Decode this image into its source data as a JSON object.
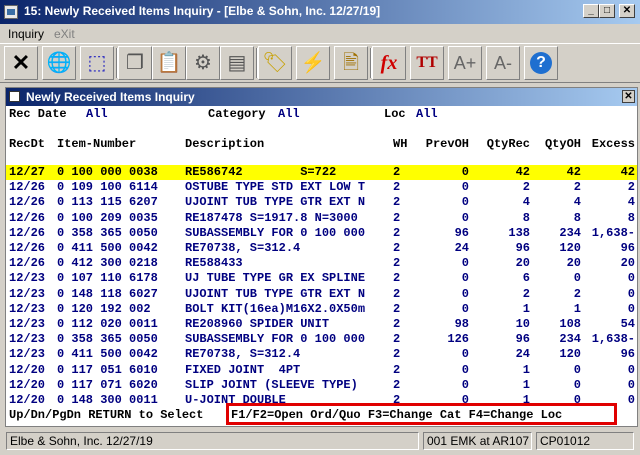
{
  "window": {
    "title": "15: Newly Received Items Inquiry - [Elbe & Sohn, Inc. 12/27/19]"
  },
  "menu": {
    "items": [
      "Inquiry",
      "eXit"
    ]
  },
  "toolbar": {
    "buttons": [
      {
        "icon": "close-x-icon",
        "glyph": "✕",
        "color": "#000"
      },
      {
        "icon": "globe-icon",
        "glyph": "🌐",
        "color": "#1e4fa0"
      },
      {
        "icon": "select-box-icon",
        "glyph": "⬚",
        "color": "#2020c0"
      },
      {
        "icon": "copy-icon",
        "glyph": "❐",
        "color": "#555"
      },
      {
        "icon": "paste-icon",
        "glyph": "📋",
        "color": "#555"
      },
      {
        "icon": "settings-gear-icon",
        "glyph": "⚙",
        "color": "#555"
      },
      {
        "icon": "document-icon",
        "glyph": "▤",
        "color": "#555"
      },
      {
        "icon": "tag-chain-icon",
        "glyph": "🏷",
        "color": "#c8a000"
      },
      {
        "icon": "lightning-icon",
        "glyph": "⚡",
        "color": "#444"
      },
      {
        "icon": "report-edit-icon",
        "glyph": "🖹",
        "color": "#a07000"
      },
      {
        "icon": "function-fx-icon",
        "glyph": "fx",
        "color": "#d00000"
      },
      {
        "icon": "font-type-icon",
        "glyph": "TT",
        "color": "#b00000"
      },
      {
        "icon": "font-increase-icon",
        "glyph": "A+",
        "color": "#666"
      },
      {
        "icon": "font-decrease-icon",
        "glyph": "A-",
        "color": "#666"
      },
      {
        "icon": "help-icon",
        "glyph": "?",
        "color": "#fff"
      }
    ]
  },
  "inquiry": {
    "title": "Newly Received Items Inquiry",
    "filters": {
      "recdate_label": "Rec Date",
      "recdate_value": "All",
      "category_label": "Category",
      "category_value": "All",
      "loc_label": "Loc",
      "loc_value": "All"
    },
    "columns": [
      "RecDt",
      "Item-Number",
      "Description",
      "WH",
      "PrevOH",
      "QtyRec",
      "QtyOH",
      "Excess"
    ],
    "rows": [
      [
        "12/27",
        "0 100 000 0038",
        "RE586742        S=722",
        "2",
        "0",
        "42",
        "42",
        "42"
      ],
      [
        "12/26",
        "0 109 100 6114",
        "OSTUBE TYPE STD EXT LOW T",
        "2",
        "0",
        "2",
        "2",
        "2"
      ],
      [
        "12/26",
        "0 113 115 6207",
        "UJOINT TUB TYPE GTR EXT N",
        "2",
        "0",
        "4",
        "4",
        "4"
      ],
      [
        "12/26",
        "0 100 209 0035",
        "RE187478 S=1917.8 N=3000",
        "2",
        "0",
        "8",
        "8",
        "8"
      ],
      [
        "12/26",
        "0 358 365 0050",
        "SUBASSEMBLY FOR 0 100 000",
        "2",
        "96",
        "138",
        "234",
        "1,638-"
      ],
      [
        "12/26",
        "0 411 500 0042",
        "RE70738, S=312.4",
        "2",
        "24",
        "96",
        "120",
        "96"
      ],
      [
        "12/26",
        "0 412 300 0218",
        "RE588433",
        "2",
        "0",
        "20",
        "20",
        "20"
      ],
      [
        "12/23",
        "0 107 110 6178",
        "UJ TUBE TYPE GR EX SPLINE",
        "2",
        "0",
        "6",
        "0",
        "0"
      ],
      [
        "12/23",
        "0 148 118 6027",
        "UJOINT TUB TYPE GTR EXT N",
        "2",
        "0",
        "2",
        "2",
        "0"
      ],
      [
        "12/23",
        "0 120 192 002",
        "BOLT KIT(16ea)M16X2.0X50m",
        "2",
        "0",
        "1",
        "1",
        "0"
      ],
      [
        "12/23",
        "0 112 020 0011",
        "RE208960 SPIDER UNIT",
        "2",
        "98",
        "10",
        "108",
        "54"
      ],
      [
        "12/23",
        "0 358 365 0050",
        "SUBASSEMBLY FOR 0 100 000",
        "2",
        "126",
        "96",
        "234",
        "1,638-"
      ],
      [
        "12/23",
        "0 411 500 0042",
        "RE70738, S=312.4",
        "2",
        "0",
        "24",
        "120",
        "96"
      ],
      [
        "12/20",
        "0 117 051 6010",
        "FIXED JOINT  4PT",
        "2",
        "0",
        "1",
        "0",
        "0"
      ],
      [
        "12/20",
        "0 117 071 6020",
        "SLIP JOINT (SLEEVE TYPE)",
        "2",
        "0",
        "1",
        "0",
        "0"
      ],
      [
        "12/20",
        "0 148 300 0011",
        "U-JOINT DOUBLE",
        "2",
        "0",
        "1",
        "0",
        "0"
      ]
    ],
    "footer": {
      "nav_hint": "Up/Dn/PgDn RETURN to Select",
      "fkeys": "F1/F2=Open Ord/Quo F3=Change Cat F4=Change Loc"
    }
  },
  "statusbar": {
    "company": "Elbe & Sohn, Inc. 12/27/19",
    "user": "001 EMK at AR107",
    "code": "CP01012"
  }
}
